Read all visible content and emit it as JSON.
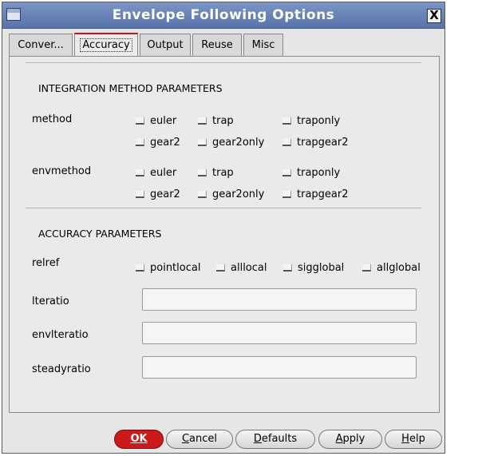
{
  "window": {
    "title": "Envelope Following Options",
    "close_label": "X"
  },
  "tabs": [
    {
      "label": "Conver..."
    },
    {
      "label": "Accuracy"
    },
    {
      "label": "Output"
    },
    {
      "label": "Reuse"
    },
    {
      "label": "Misc"
    }
  ],
  "integration": {
    "heading": "INTEGRATION METHOD PARAMETERS",
    "method": {
      "label": "method",
      "options": [
        "euler",
        "trap",
        "traponly",
        "gear2",
        "gear2only",
        "trapgear2"
      ]
    },
    "envmethod": {
      "label": "envmethod",
      "options": [
        "euler",
        "trap",
        "traponly",
        "gear2",
        "gear2only",
        "trapgear2"
      ]
    }
  },
  "accuracy": {
    "heading": "ACCURACY PARAMETERS",
    "relref": {
      "label": "relref",
      "options": [
        "pointlocal",
        "alllocal",
        "sigglobal",
        "allglobal"
      ]
    },
    "lteratio": {
      "label": "lteratio",
      "value": ""
    },
    "envlteratio": {
      "label": "envlteratio",
      "value": ""
    },
    "steadyratio": {
      "label": "steadyratio",
      "value": ""
    }
  },
  "buttons": {
    "ok": "OK",
    "cancel_first": "C",
    "cancel_rest": "ancel",
    "defaults_first": "D",
    "defaults_rest": "efaults",
    "apply_first": "A",
    "apply_rest": "pply",
    "help_first": "H",
    "help_rest": "elp"
  }
}
